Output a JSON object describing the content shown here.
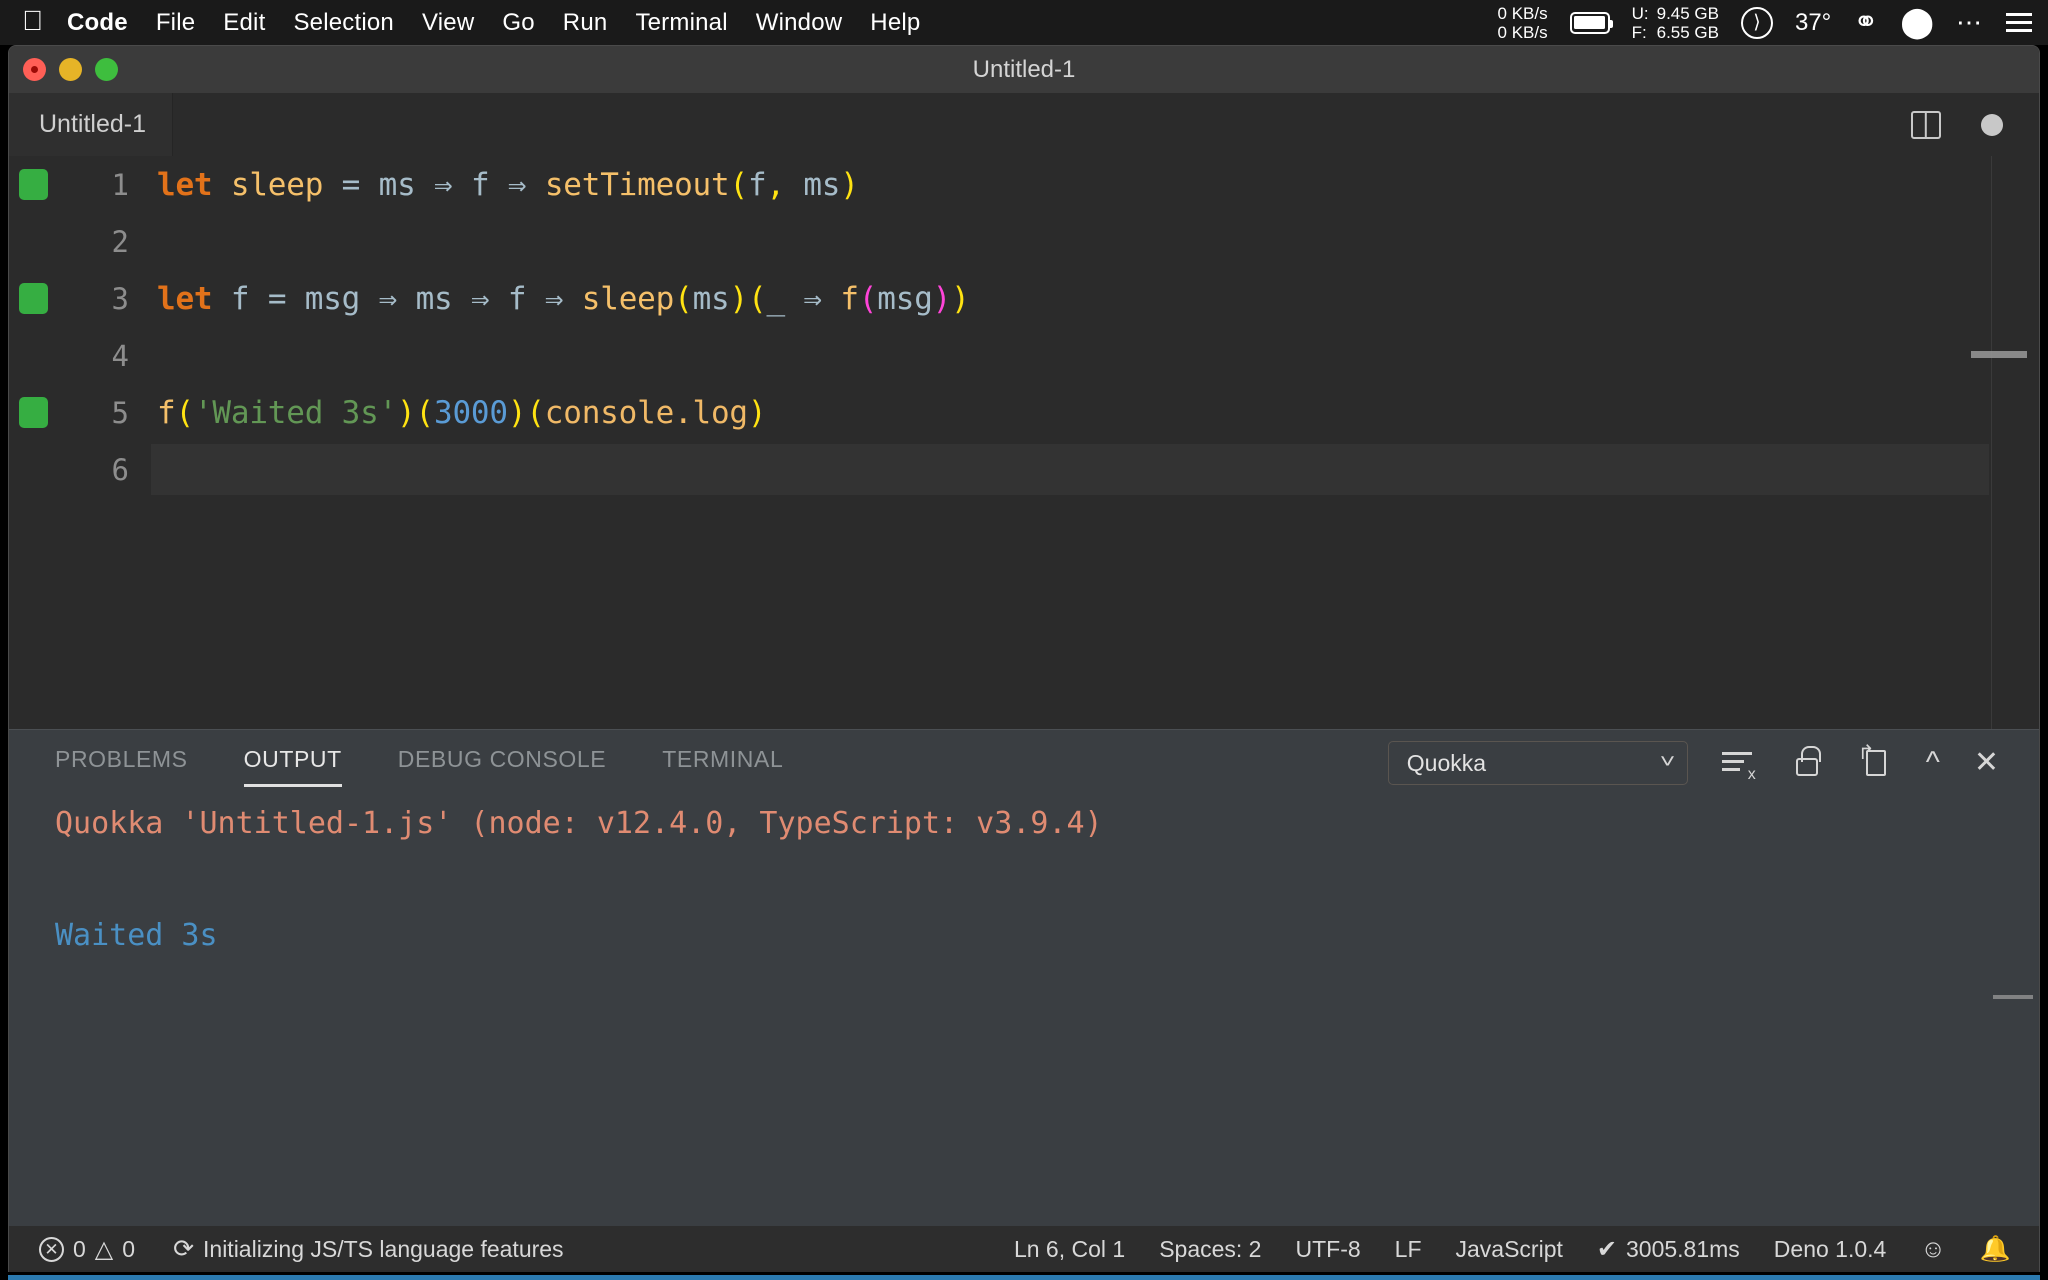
{
  "menubar": {
    "apple_icon": "apple-logo",
    "items": [
      {
        "label": "Code",
        "bold": true
      },
      {
        "label": "File",
        "bold": false
      },
      {
        "label": "Edit",
        "bold": false
      },
      {
        "label": "Selection",
        "bold": false
      },
      {
        "label": "View",
        "bold": false
      },
      {
        "label": "Go",
        "bold": false
      },
      {
        "label": "Run",
        "bold": false
      },
      {
        "label": "Terminal",
        "bold": false
      },
      {
        "label": "Window",
        "bold": false
      },
      {
        "label": "Help",
        "bold": false
      }
    ],
    "status": {
      "net_up": "0 KB/s",
      "net_down": "0 KB/s",
      "battery_icon": "battery-icon",
      "mem_used_label": "U:",
      "mem_free_label": "F:",
      "mem_used": "9.45 GB",
      "mem_free": "6.55 GB",
      "moon_icon": "moon-phase-icon",
      "temperature": "37°",
      "eye_icon": "eye-privacy-icon",
      "shield_icon": "shield-icon",
      "more_icon": "ellipsis-icon",
      "menu_icon": "list-menu-icon"
    }
  },
  "window": {
    "title": "Untitled-1",
    "traffic": {
      "close": "close-button",
      "minimize": "minimize-button",
      "zoom": "zoom-button"
    }
  },
  "tabs": {
    "items": [
      {
        "label": "Untitled-1",
        "active": true
      }
    ],
    "actions": {
      "split_editor": "split-editor-icon",
      "more_actions": "more-actions-dot"
    }
  },
  "editor": {
    "language": "JavaScript",
    "lines": [
      {
        "number": "1",
        "quokka": true,
        "current": false,
        "tokens": [
          {
            "t": "let",
            "c": "t-key"
          },
          {
            "t": " ",
            "c": "t-punc"
          },
          {
            "t": "sleep",
            "c": "t-fn"
          },
          {
            "t": " ",
            "c": "t-punc"
          },
          {
            "t": "=",
            "c": "t-op"
          },
          {
            "t": " ",
            "c": "t-punc"
          },
          {
            "t": "ms",
            "c": "t-var"
          },
          {
            "t": " ",
            "c": "t-punc"
          },
          {
            "t": "⇒",
            "c": "t-arrow"
          },
          {
            "t": " ",
            "c": "t-punc"
          },
          {
            "t": "f",
            "c": "t-var"
          },
          {
            "t": " ",
            "c": "t-punc"
          },
          {
            "t": "⇒",
            "c": "t-arrow"
          },
          {
            "t": " ",
            "c": "t-punc"
          },
          {
            "t": "setTimeout",
            "c": "t-fn"
          },
          {
            "t": "(",
            "c": "p-yellow"
          },
          {
            "t": "f",
            "c": "t-var"
          },
          {
            "t": ",",
            "c": "p-yellow"
          },
          {
            "t": " ",
            "c": "t-punc"
          },
          {
            "t": "ms",
            "c": "t-var"
          },
          {
            "t": ")",
            "c": "p-yellow"
          }
        ]
      },
      {
        "number": "2",
        "quokka": false,
        "current": false,
        "tokens": []
      },
      {
        "number": "3",
        "quokka": true,
        "current": false,
        "tokens": [
          {
            "t": "let",
            "c": "t-key"
          },
          {
            "t": " ",
            "c": "t-punc"
          },
          {
            "t": "f",
            "c": "t-var"
          },
          {
            "t": " ",
            "c": "t-punc"
          },
          {
            "t": "=",
            "c": "t-op"
          },
          {
            "t": " ",
            "c": "t-punc"
          },
          {
            "t": "msg",
            "c": "t-var"
          },
          {
            "t": " ",
            "c": "t-punc"
          },
          {
            "t": "⇒",
            "c": "t-arrow"
          },
          {
            "t": " ",
            "c": "t-punc"
          },
          {
            "t": "ms",
            "c": "t-var"
          },
          {
            "t": " ",
            "c": "t-punc"
          },
          {
            "t": "⇒",
            "c": "t-arrow"
          },
          {
            "t": " ",
            "c": "t-punc"
          },
          {
            "t": "f",
            "c": "t-var"
          },
          {
            "t": " ",
            "c": "t-punc"
          },
          {
            "t": "⇒",
            "c": "t-arrow"
          },
          {
            "t": " ",
            "c": "t-punc"
          },
          {
            "t": "sleep",
            "c": "t-fn"
          },
          {
            "t": "(",
            "c": "p-yellow"
          },
          {
            "t": "ms",
            "c": "t-var"
          },
          {
            "t": ")",
            "c": "p-yellow"
          },
          {
            "t": "(",
            "c": "p-yellow"
          },
          {
            "t": "_",
            "c": "t-var"
          },
          {
            "t": " ",
            "c": "t-punc"
          },
          {
            "t": "⇒",
            "c": "t-arrow"
          },
          {
            "t": " ",
            "c": "t-punc"
          },
          {
            "t": "f",
            "c": "t-fn"
          },
          {
            "t": "(",
            "c": "p-magenta"
          },
          {
            "t": "msg",
            "c": "t-var"
          },
          {
            "t": ")",
            "c": "p-magenta"
          },
          {
            "t": ")",
            "c": "p-yellow"
          }
        ]
      },
      {
        "number": "4",
        "quokka": false,
        "current": false,
        "tokens": []
      },
      {
        "number": "5",
        "quokka": true,
        "current": false,
        "tokens": [
          {
            "t": "f",
            "c": "t-fn"
          },
          {
            "t": "(",
            "c": "p-yellow"
          },
          {
            "t": "'Waited 3s'",
            "c": "t-str"
          },
          {
            "t": ")",
            "c": "p-yellow"
          },
          {
            "t": "(",
            "c": "p-yellow"
          },
          {
            "t": "3000",
            "c": "t-num"
          },
          {
            "t": ")",
            "c": "p-yellow"
          },
          {
            "t": "(",
            "c": "p-yellow"
          },
          {
            "t": "console.log",
            "c": "t-prop"
          },
          {
            "t": ")",
            "c": "p-yellow"
          }
        ]
      },
      {
        "number": "6",
        "quokka": false,
        "current": true,
        "tokens": []
      }
    ]
  },
  "panel": {
    "tabs": [
      {
        "label": "PROBLEMS",
        "active": false
      },
      {
        "label": "OUTPUT",
        "active": true
      },
      {
        "label": "DEBUG CONSOLE",
        "active": false
      },
      {
        "label": "TERMINAL",
        "active": false
      }
    ],
    "channel_select": {
      "value": "Quokka",
      "chevron": "chevron-down-icon"
    },
    "tools": {
      "clear_output": "clear-output-icon",
      "lock_scrolling": "lock-icon",
      "open_in_editor": "open-in-new-editor-icon",
      "maximize": "chevron-up-icon",
      "close": "close-panel-icon"
    },
    "output": [
      {
        "text": "Quokka 'Untitled-1.js' (node: v12.4.0, TypeScript: v3.9.4)",
        "style": "out-quokka"
      },
      {
        "text": "",
        "style": "out-value"
      },
      {
        "text": "Waited 3s",
        "style": "out-value"
      }
    ]
  },
  "statusbar": {
    "errors_icon": "error-circle-icon",
    "errors": "0",
    "warnings_icon": "warning-triangle-icon",
    "warnings": "0",
    "sync_icon": "sync-spinner-icon",
    "task_message": "Initializing JS/TS language features",
    "cursor_position": "Ln 6, Col 1",
    "indentation": "Spaces: 2",
    "encoding": "UTF-8",
    "eol": "LF",
    "language_mode": "JavaScript",
    "run_check_icon": "check-icon",
    "run_time": "3005.81ms",
    "runtime": "Deno 1.0.4",
    "feedback_icon": "feedback-icon",
    "bell_icon": "bell-icon"
  },
  "colors": {
    "accent": "#2b7ab0",
    "quokka_green": "#36ae42",
    "panel_bg": "#3a3e42",
    "editor_bg": "#2b2b2b"
  }
}
